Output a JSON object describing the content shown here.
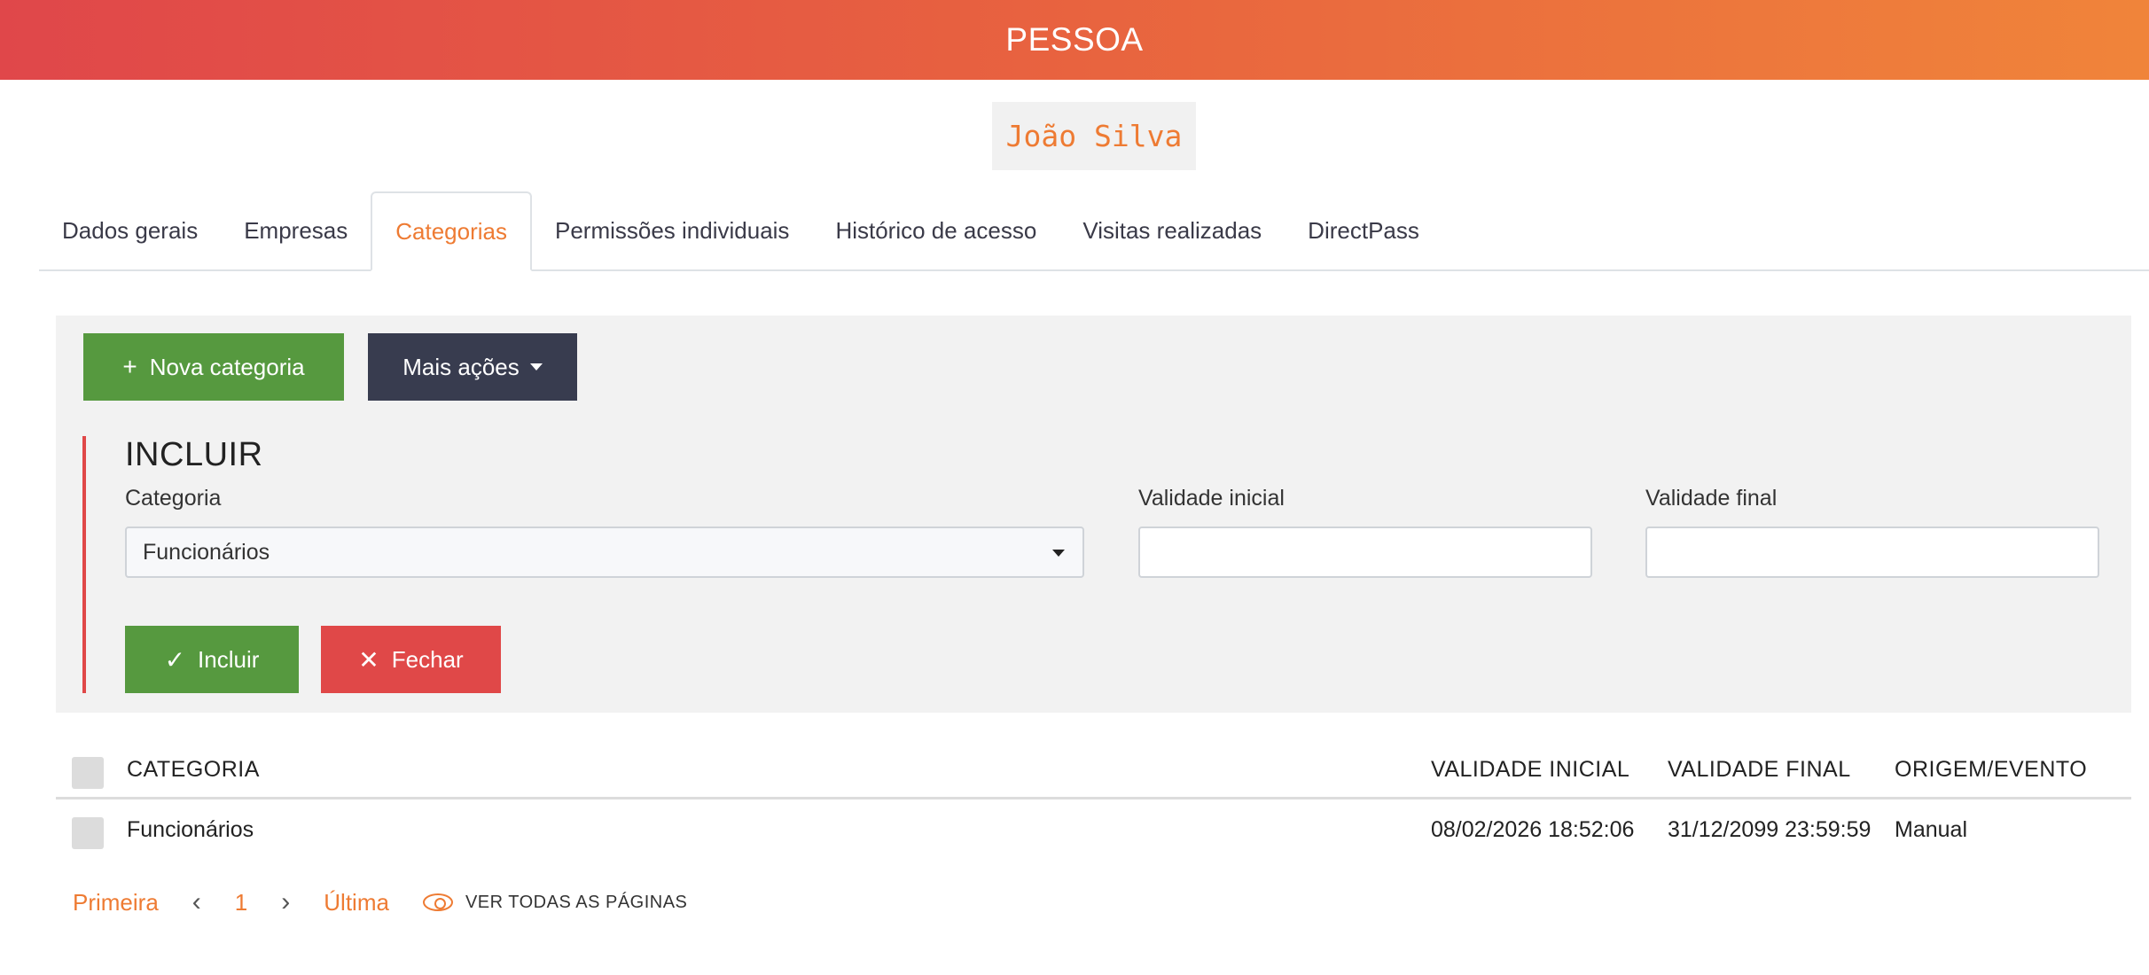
{
  "header": {
    "title": "PESSOA"
  },
  "person": {
    "name": "João Silva"
  },
  "tabs": [
    {
      "label": "Dados gerais",
      "active": false
    },
    {
      "label": "Empresas",
      "active": false
    },
    {
      "label": "Categorias",
      "active": true
    },
    {
      "label": "Permissões individuais",
      "active": false
    },
    {
      "label": "Histórico de acesso",
      "active": false
    },
    {
      "label": "Visitas realizadas",
      "active": false
    },
    {
      "label": "DirectPass",
      "active": false
    }
  ],
  "toolbar": {
    "new_category_label": "Nova categoria",
    "more_actions_label": "Mais ações"
  },
  "include_form": {
    "title": "INCLUIR",
    "category_label": "Categoria",
    "category_value": "Funcionários",
    "start_label": "Validade inicial",
    "start_value": "",
    "end_label": "Validade final",
    "end_value": "",
    "include_label": "Incluir",
    "close_label": "Fechar"
  },
  "table": {
    "headers": {
      "category": "CATEGORIA",
      "start": "VALIDADE INICIAL",
      "end": "VALIDADE FINAL",
      "origin": "ORIGEM/EVENTO"
    },
    "rows": [
      {
        "category": "Funcionários",
        "start": "08/02/2026 18:52:06",
        "end": "31/12/2099 23:59:59",
        "origin": "Manual"
      }
    ]
  },
  "pagination": {
    "first": "Primeira",
    "current": "1",
    "last": "Última",
    "see_all": "VER TODAS AS PÁGINAS"
  },
  "colors": {
    "accent": "#ee7b33",
    "success": "#56993f",
    "danger": "#e04848",
    "dark": "#383c4f"
  }
}
